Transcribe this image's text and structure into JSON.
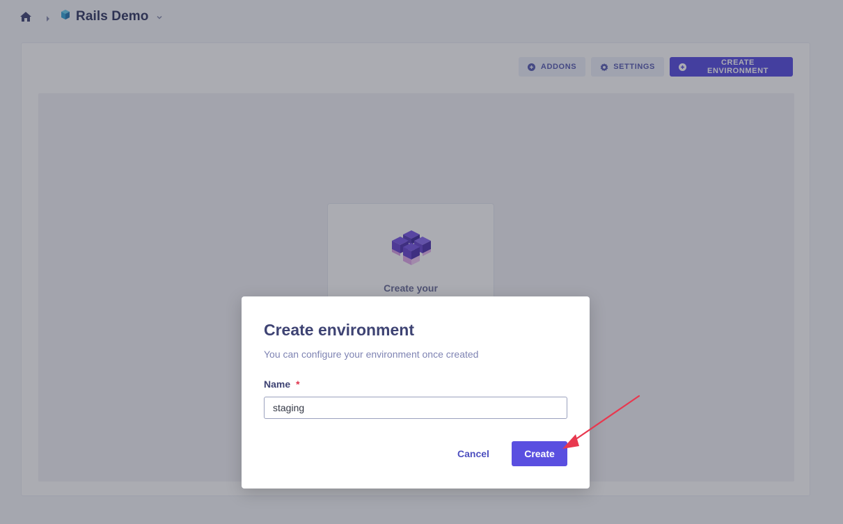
{
  "header": {
    "project_name": "Rails Demo",
    "icons": {
      "home": "home-icon",
      "separator": "chevron-right-icon",
      "project": "project-icon",
      "dropdown": "chevron-down-icon"
    }
  },
  "toolbar": {
    "addons_label": "ADDONS",
    "settings_label": "SETTINGS",
    "create_environment_label": "CREATE ENVIRONMENT"
  },
  "empty_state": {
    "title": "Create your"
  },
  "modal": {
    "title": "Create environment",
    "subtitle": "You can configure your environment once created",
    "name_label": "Name",
    "required_marker": "*",
    "name_value": "staging",
    "cancel_label": "Cancel",
    "create_label": "Create"
  },
  "colors": {
    "accent": "#5a4fe0",
    "heading": "#3e4373",
    "required": "#e0334c",
    "annotation_arrow": "#e8384f"
  }
}
